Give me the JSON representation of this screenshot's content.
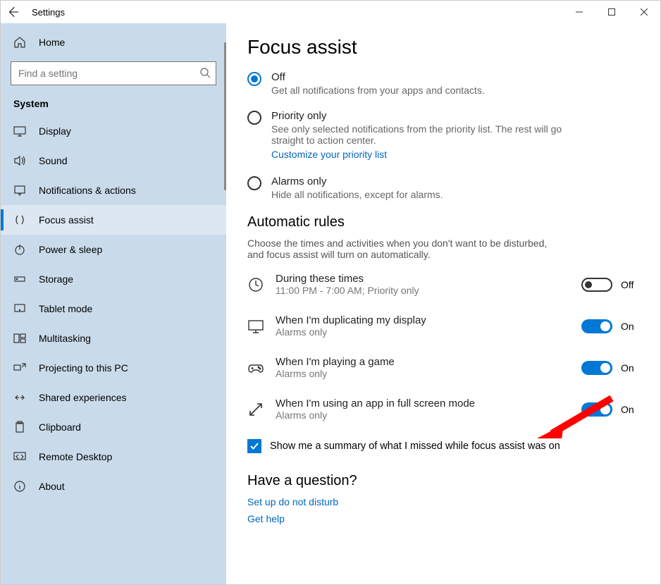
{
  "titlebar": {
    "title": "Settings"
  },
  "sidebar": {
    "home_label": "Home",
    "search_placeholder": "Find a setting",
    "heading": "System",
    "items": [
      {
        "icon": "display",
        "label": "Display"
      },
      {
        "icon": "sound",
        "label": "Sound"
      },
      {
        "icon": "notifications",
        "label": "Notifications & actions"
      },
      {
        "icon": "focus",
        "label": "Focus assist"
      },
      {
        "icon": "power",
        "label": "Power & sleep"
      },
      {
        "icon": "storage",
        "label": "Storage"
      },
      {
        "icon": "tablet",
        "label": "Tablet mode"
      },
      {
        "icon": "multitask",
        "label": "Multitasking"
      },
      {
        "icon": "project",
        "label": "Projecting to this PC"
      },
      {
        "icon": "shared",
        "label": "Shared experiences"
      },
      {
        "icon": "clipboard",
        "label": "Clipboard"
      },
      {
        "icon": "remote",
        "label": "Remote Desktop"
      },
      {
        "icon": "about",
        "label": "About"
      }
    ]
  },
  "main": {
    "heading": "Focus assist",
    "radios": [
      {
        "label": "Off",
        "desc": "Get all notifications from your apps and contacts.",
        "selected": true
      },
      {
        "label": "Priority only",
        "desc": "See only selected notifications from the priority list. The rest will go straight to action center.",
        "link": "Customize your priority list"
      },
      {
        "label": "Alarms only",
        "desc": "Hide all notifications, except for alarms."
      }
    ],
    "rules_heading": "Automatic rules",
    "rules_intro": "Choose the times and activities when you don't want to be disturbed, and focus assist will turn on automatically.",
    "rules": [
      {
        "icon": "clock",
        "title": "During these times",
        "sub": "11:00 PM - 7:00 AM; Priority only",
        "state": "Off",
        "on": false
      },
      {
        "icon": "monitor",
        "title": "When I'm duplicating my display",
        "sub": "Alarms only",
        "state": "On",
        "on": true
      },
      {
        "icon": "game",
        "title": "When I'm playing a game",
        "sub": "Alarms only",
        "state": "On",
        "on": true
      },
      {
        "icon": "fullscreen",
        "title": "When I'm using an app in full screen mode",
        "sub": "Alarms only",
        "state": "On",
        "on": true
      }
    ],
    "summary_checkbox": "Show me a summary of what I missed while focus assist was on",
    "question_heading": "Have a question?",
    "question_link": "Set up do not disturb",
    "question_link2": "Get help"
  }
}
